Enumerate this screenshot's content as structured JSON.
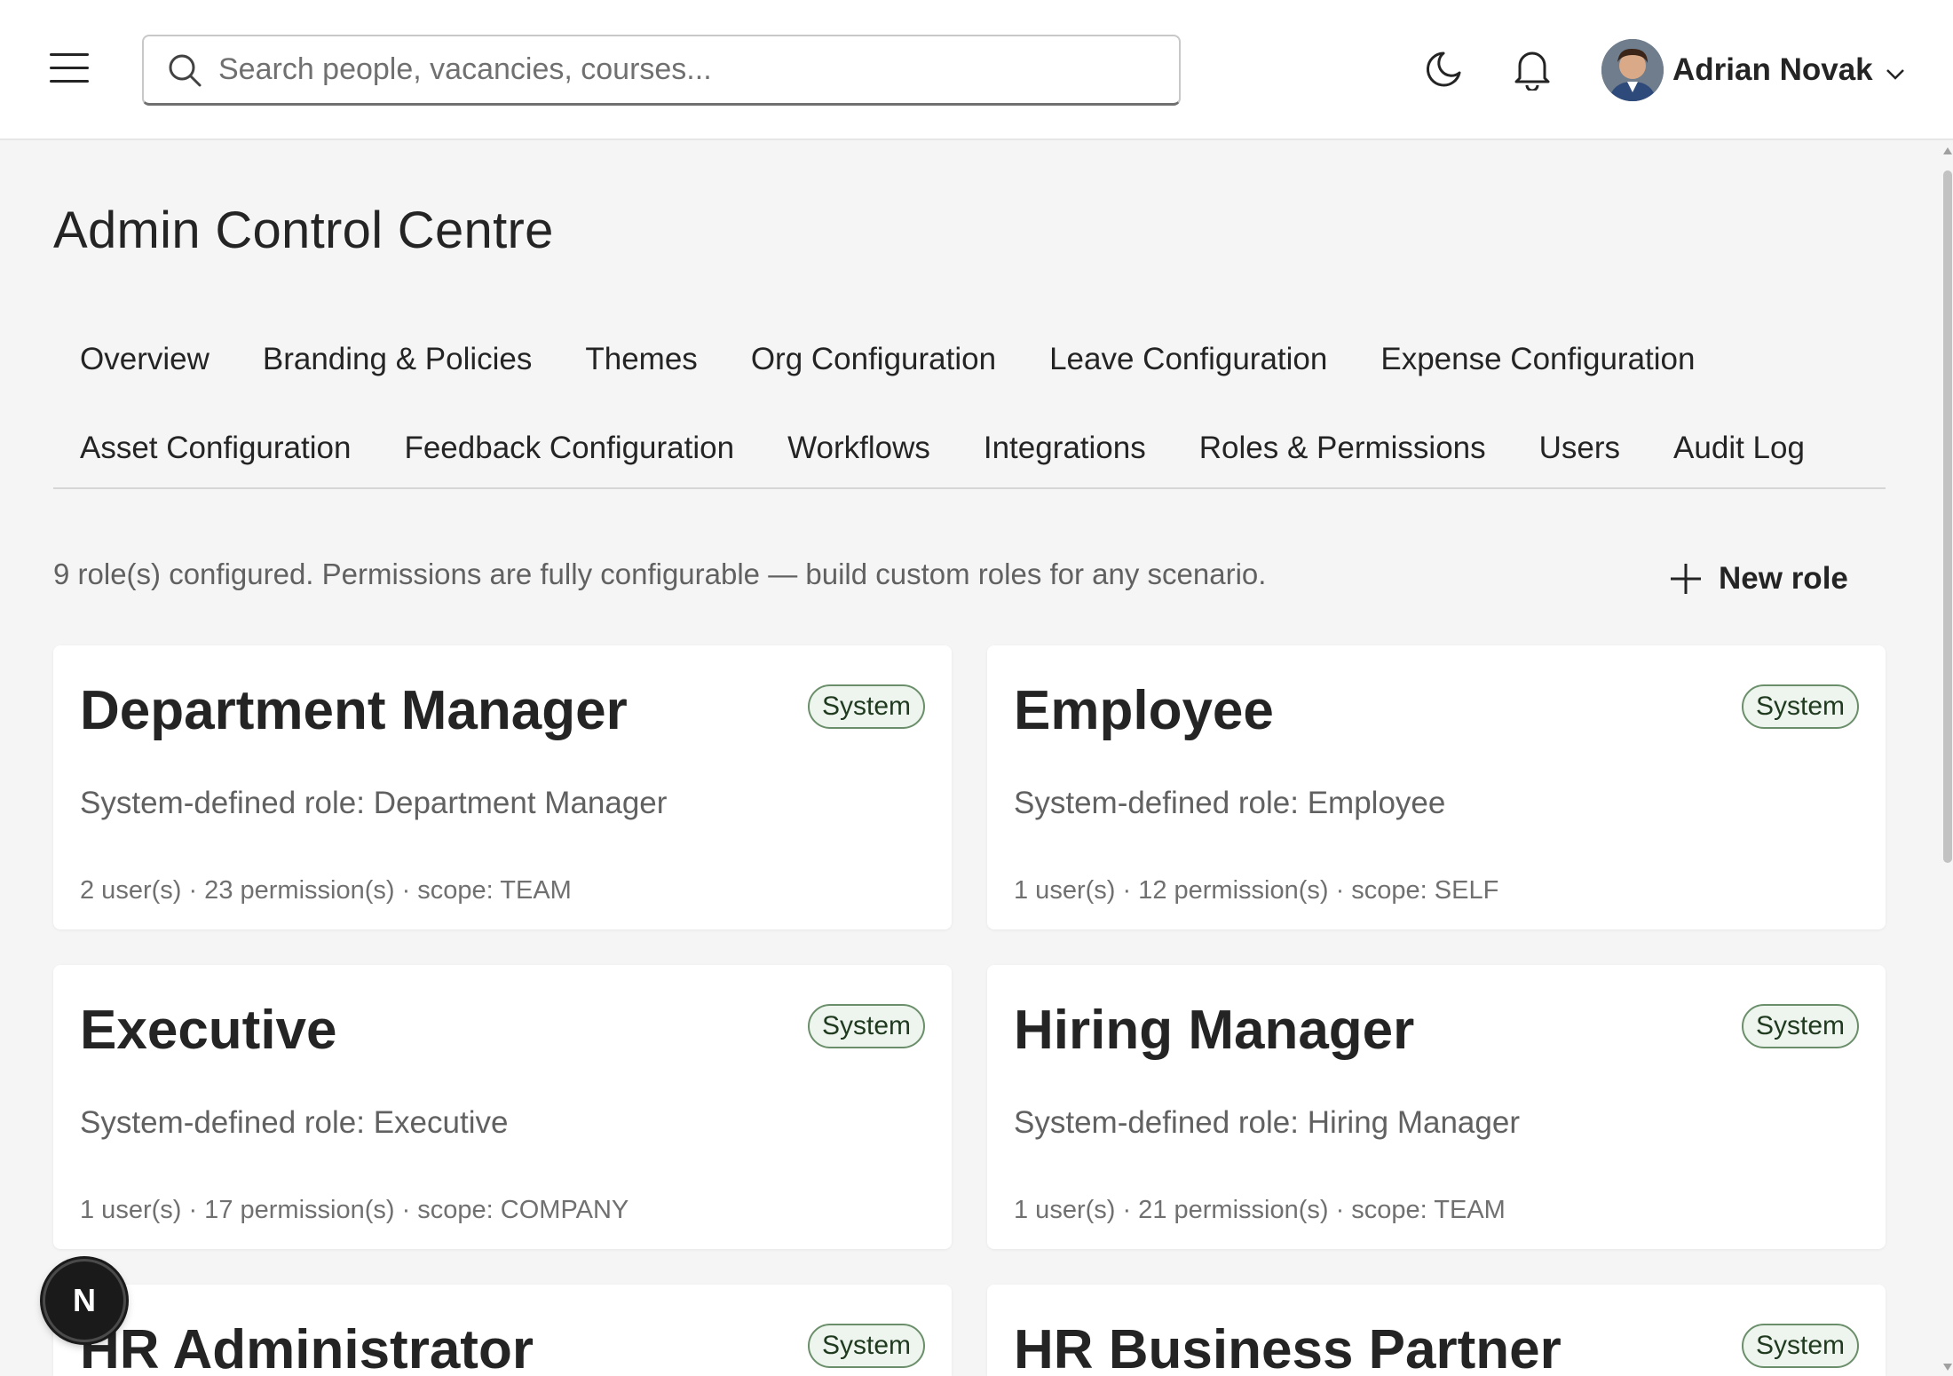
{
  "header": {
    "search_placeholder": "Search people, vacancies, courses...",
    "user_name": "Adrian Novak"
  },
  "page": {
    "title": "Admin Control Centre",
    "summary": "9 role(s) configured. Permissions are fully configurable — build custom roles for any scenario.",
    "new_role_label": "New role"
  },
  "tabs": {
    "row1": [
      "Overview",
      "Branding & Policies",
      "Themes",
      "Org Configuration",
      "Leave Configuration",
      "Expense Configuration"
    ],
    "row2": [
      "Asset Configuration",
      "Feedback Configuration",
      "Workflows",
      "Integrations",
      "Roles & Permissions",
      "Users",
      "Audit Log"
    ]
  },
  "roles": [
    {
      "name": "Department Manager",
      "badge": "System",
      "description": "System-defined role: Department Manager",
      "meta": "2 user(s) · 23 permission(s) · scope: TEAM"
    },
    {
      "name": "Employee",
      "badge": "System",
      "description": "System-defined role: Employee",
      "meta": "1 user(s) · 12 permission(s) · scope: SELF"
    },
    {
      "name": "Executive",
      "badge": "System",
      "description": "System-defined role: Executive",
      "meta": "1 user(s) · 17 permission(s) · scope: COMPANY"
    },
    {
      "name": "Hiring Manager",
      "badge": "System",
      "description": "System-defined role: Hiring Manager",
      "meta": "1 user(s) · 21 permission(s) · scope: TEAM"
    },
    {
      "name": "HR Administrator",
      "badge": "System",
      "description": "",
      "meta": ""
    },
    {
      "name": "HR Business Partner",
      "badge": "System",
      "description": "",
      "meta": ""
    }
  ],
  "fab": {
    "letter": "N"
  },
  "colors": {
    "badge_border": "#6a8f6a",
    "badge_bg": "#eef5ee",
    "page_bg": "#f5f5f5"
  }
}
